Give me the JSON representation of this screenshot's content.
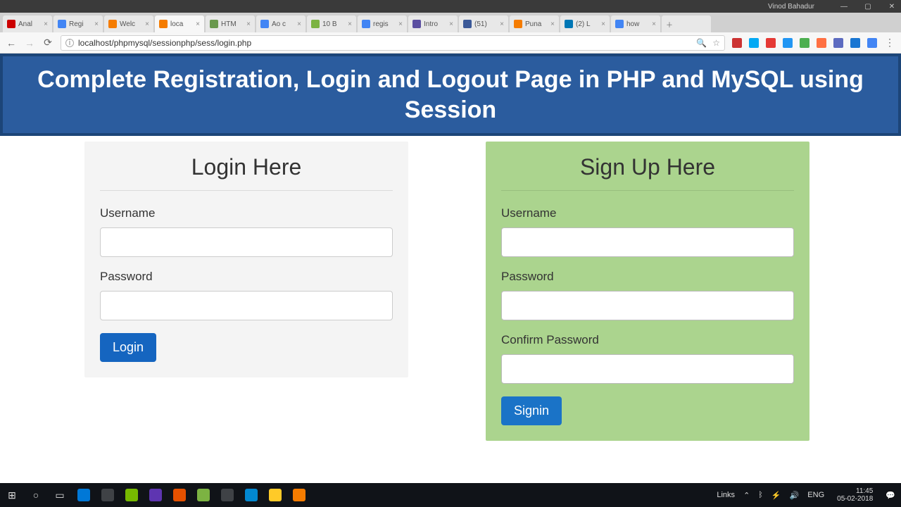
{
  "window": {
    "user": "Vinod Bahadur",
    "min": "—",
    "max": "▢",
    "close": "✕"
  },
  "tabs": [
    {
      "label": "Anal",
      "fav": "#cc0000"
    },
    {
      "label": "Regi",
      "fav": "#4285f4"
    },
    {
      "label": "Welc",
      "fav": "#f57c00"
    },
    {
      "label": "loca",
      "fav": "#f57c00",
      "active": true
    },
    {
      "label": "HTM",
      "fav": "#6a994e"
    },
    {
      "label": "Ao c",
      "fav": "#4285f4"
    },
    {
      "label": "10 B",
      "fav": "#7cb342"
    },
    {
      "label": "regis",
      "fav": "#4285f4"
    },
    {
      "label": "Intro",
      "fav": "#5b4fa1"
    },
    {
      "label": "(51)",
      "fav": "#3b5998"
    },
    {
      "label": "Puna",
      "fav": "#f57c00"
    },
    {
      "label": "(2) L",
      "fav": "#0077b5"
    },
    {
      "label": "how",
      "fav": "#4285f4"
    }
  ],
  "newtab": "＋",
  "addr": {
    "back": "←",
    "fwd": "→",
    "reload": "⟳",
    "info": "i",
    "url": "localhost/phpmysql/sessionphp/sess/login.php",
    "zoom": "🔍",
    "star": "☆",
    "menu": "⋮"
  },
  "ext_colors": [
    "#c33",
    "#03a9f4",
    "#e53935",
    "#2196f3",
    "#4caf50",
    "#ff7043",
    "#5c6bc0",
    "#1976d2",
    "#4285f4"
  ],
  "page": {
    "banner": "Complete Registration, Login and Logout Page in PHP and MySQL using Session",
    "login": {
      "heading": "Login Here",
      "username_label": "Username",
      "password_label": "Password",
      "button": "Login"
    },
    "signup": {
      "heading": "Sign Up Here",
      "username_label": "Username",
      "password_label": "Password",
      "confirm_label": "Confirm Password",
      "button": "Signin"
    }
  },
  "taskbar": {
    "start": "⊞",
    "cortana": "○",
    "taskview": "▭",
    "links_label": "Links",
    "lang": "ENG",
    "time": "11:45",
    "date": "05-02-2018",
    "notif": "💬"
  },
  "task_icons": [
    "#0078d7",
    "#ffffff33",
    "#76b900",
    "#5e35b1",
    "#e65100",
    "#7cb342",
    "#ffffff33",
    "#0288d1",
    "#ffca28",
    "#f57c00"
  ]
}
